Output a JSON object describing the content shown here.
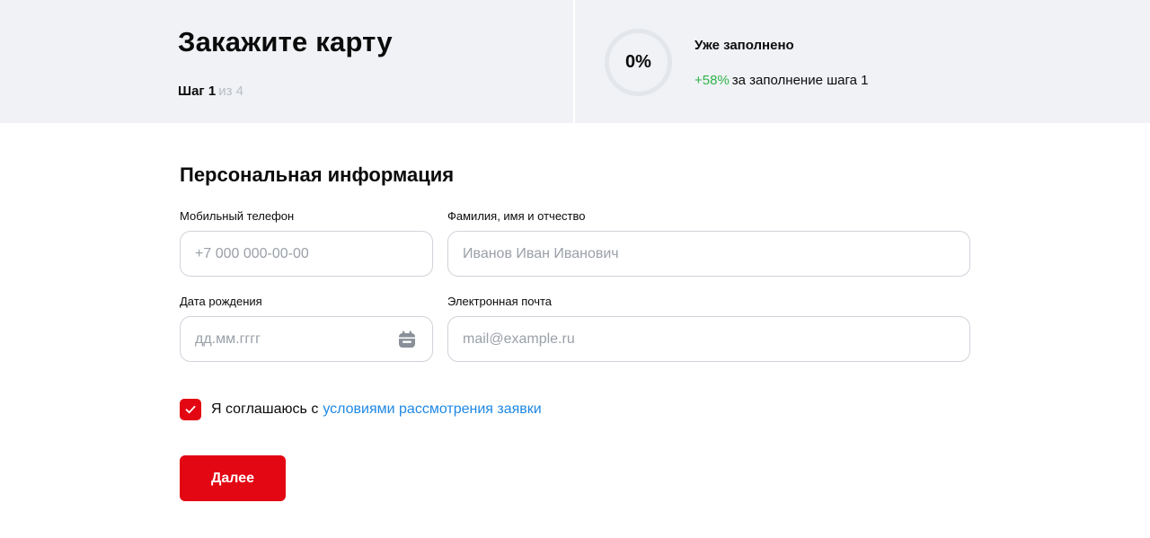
{
  "header": {
    "title": "Закажите карту",
    "step_current": "Шаг 1",
    "step_total": "из 4",
    "progress": {
      "value_text": "0%",
      "value": 0,
      "filled_title": "Уже заполнено",
      "bonus_percent": "+58%",
      "bonus_text": "за заполнение шага 1"
    }
  },
  "form": {
    "section_title": "Персональная информация",
    "fields": {
      "phone": {
        "label": "Мобильный телефон",
        "value": "",
        "placeholder": "+7 000 000-00-00"
      },
      "full_name": {
        "label": "Фамилия, имя и отчество",
        "value": "",
        "placeholder": "Иванов Иван Иванович"
      },
      "birth_date": {
        "label": "Дата рождения",
        "value": "",
        "placeholder": "дд.мм.гггг",
        "icon": "calendar-icon"
      },
      "email": {
        "label": "Электронная почта",
        "value": "",
        "placeholder": "mail@example.ru"
      }
    },
    "consent": {
      "checked": true,
      "text": "Я соглашаюсь с",
      "link_text": "условиями рассмотрения заявки"
    },
    "next_button": "Далее"
  },
  "colors": {
    "accent": "#e30613",
    "link": "#1e88e5",
    "bonus": "#2fb44a",
    "header_bg": "#f0f2f5"
  }
}
